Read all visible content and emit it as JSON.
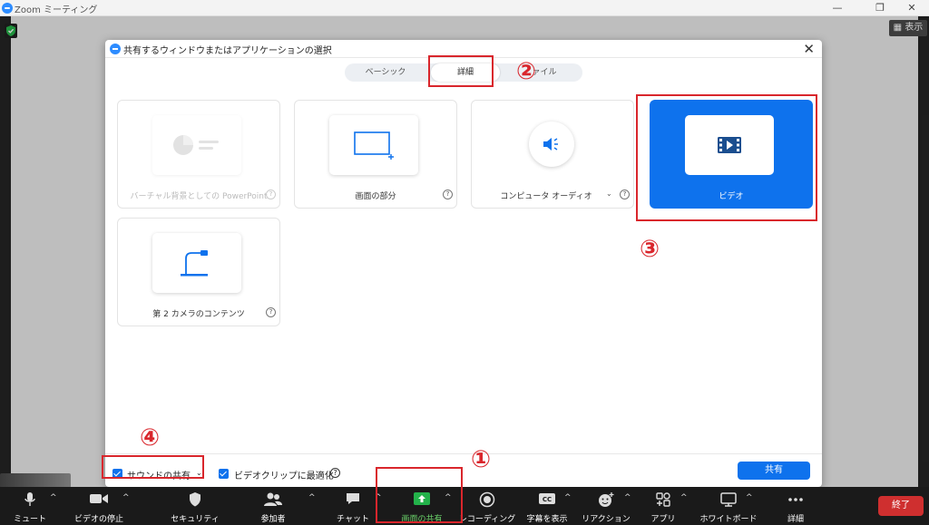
{
  "window": {
    "title": "Zoom ミーティング",
    "minimize": "—",
    "restore": "❐",
    "close": "✕"
  },
  "view_button": "表示",
  "dialog": {
    "title": "共有するウィンドウまたはアプリケーションの選択",
    "close": "✕",
    "tabs": [
      {
        "label": "ベーシック",
        "active": false
      },
      {
        "label": "詳細",
        "active": true
      },
      {
        "label": "ァイル",
        "active": false
      }
    ],
    "cards": [
      {
        "label": "バーチャル背景としての PowerPoint",
        "disabled": true,
        "icon": "pie-chart-icon"
      },
      {
        "label": "画面の部分",
        "icon": "screen-portion-icon"
      },
      {
        "label": "コンピュータ オーディオ",
        "icon": "speaker-icon",
        "has_dropdown": true
      },
      {
        "label": "ビデオ",
        "selected": true,
        "icon": "film-icon"
      },
      {
        "label": "第 2 カメラのコンテンツ",
        "icon": "document-camera-icon"
      }
    ],
    "footer": {
      "share_sound": "サウンドの共有",
      "share_sound_checked": true,
      "optimize_video": "ビデオクリップに最適化",
      "optimize_video_checked": true,
      "share_button": "共有"
    }
  },
  "toolbar": {
    "items": [
      {
        "label": "ミュート",
        "icon": "microphone-icon"
      },
      {
        "label": "ビデオの停止",
        "icon": "video-camera-icon"
      },
      {
        "label": "セキュリティ",
        "icon": "security-shield-icon"
      },
      {
        "label": "参加者",
        "icon": "participants-icon"
      },
      {
        "label": "チャット",
        "icon": "chat-icon"
      },
      {
        "label": "画面の共有",
        "icon": "share-screen-icon",
        "active": true
      },
      {
        "label": "レコーディング",
        "icon": "record-icon"
      },
      {
        "label": "字幕を表示",
        "icon": "captions-icon"
      },
      {
        "label": "リアクション",
        "icon": "reaction-icon"
      },
      {
        "label": "アプリ",
        "icon": "apps-icon"
      },
      {
        "label": "ホワイトボード",
        "icon": "whiteboard-icon"
      },
      {
        "label": "詳細",
        "icon": "more-icon"
      }
    ],
    "end_button": "終了"
  },
  "annotations": [
    "①",
    "②",
    "③",
    "④"
  ],
  "colors": {
    "accent": "#0e72ed",
    "annotation": "#d9262c",
    "end": "#cf2f2f",
    "share_active": "#6bd46b"
  }
}
